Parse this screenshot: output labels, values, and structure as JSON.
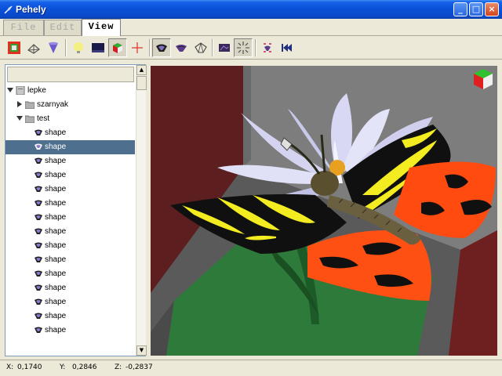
{
  "window": {
    "title": "Pehely",
    "icon": "feather-icon",
    "controls": {
      "minimize": "_",
      "maximize": "□",
      "close": "×"
    }
  },
  "menu": {
    "tabs": [
      {
        "label": "File",
        "active": false
      },
      {
        "label": "Edit",
        "active": false
      },
      {
        "label": "View",
        "active": true
      }
    ]
  },
  "toolbar": {
    "buttons": [
      {
        "icon": "frame-select-icon",
        "pressed": false
      },
      {
        "icon": "wireframe-icon",
        "pressed": false
      },
      {
        "icon": "cone-icon",
        "pressed": false
      },
      {
        "icon": "light-bulb-icon",
        "pressed": false
      },
      {
        "icon": "background-icon",
        "pressed": false
      },
      {
        "icon": "shaded-cube-icon",
        "pressed": true
      },
      {
        "icon": "axis-cross-icon",
        "pressed": false
      },
      {
        "icon": "render-solid-icon",
        "pressed": true
      },
      {
        "icon": "render-flat-icon",
        "pressed": false
      },
      {
        "icon": "render-lines-icon",
        "pressed": false
      },
      {
        "icon": "texture-icon",
        "pressed": false
      },
      {
        "icon": "explode-icon",
        "pressed": true
      },
      {
        "icon": "focus-icon",
        "pressed": false
      },
      {
        "icon": "rewind-icon",
        "pressed": false
      }
    ]
  },
  "tree": {
    "root": {
      "label": "lepke",
      "icon": "document-icon",
      "expanded": true
    },
    "children": [
      {
        "label": "szarnyak",
        "icon": "folder-icon",
        "expanded": false
      },
      {
        "label": "test",
        "icon": "folder-icon",
        "expanded": true
      }
    ],
    "shapes": [
      {
        "label": "shape",
        "selected": false
      },
      {
        "label": "shape",
        "selected": true
      },
      {
        "label": "shape",
        "selected": false
      },
      {
        "label": "shape",
        "selected": false
      },
      {
        "label": "shape",
        "selected": false
      },
      {
        "label": "shape",
        "selected": false
      },
      {
        "label": "shape",
        "selected": false
      },
      {
        "label": "shape",
        "selected": false
      },
      {
        "label": "shape",
        "selected": false
      },
      {
        "label": "shape",
        "selected": false
      },
      {
        "label": "shape",
        "selected": false
      },
      {
        "label": "shape",
        "selected": false
      },
      {
        "label": "shape",
        "selected": false
      },
      {
        "label": "shape",
        "selected": false
      },
      {
        "label": "shape",
        "selected": false
      }
    ],
    "shape_icon": "shape-icon"
  },
  "viewport": {
    "scene": "butterfly-on-daisy",
    "colors": {
      "wall_left": "#5c1e1e",
      "wall_back": "#7d7d7d",
      "floor": "#2e7a3a",
      "petal": "#d8d8f4",
      "wing_black": "#101010",
      "wing_yellow": "#f2ec20",
      "wing_orange": "#ff4a10",
      "body": "#5a5030"
    },
    "orientation_cube": "orientation-cube-icon"
  },
  "status": {
    "x_label": "X:",
    "x_value": "0,1740",
    "y_label": "Y:",
    "y_value": "0,2846",
    "z_label": "Z:",
    "z_value": "-0,2837"
  }
}
